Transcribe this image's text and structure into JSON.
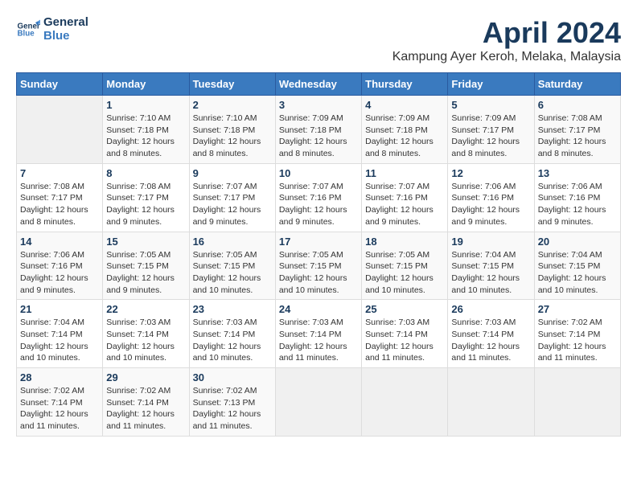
{
  "header": {
    "logo_line1": "General",
    "logo_line2": "Blue",
    "month": "April 2024",
    "location": "Kampung Ayer Keroh, Melaka, Malaysia"
  },
  "weekdays": [
    "Sunday",
    "Monday",
    "Tuesday",
    "Wednesday",
    "Thursday",
    "Friday",
    "Saturday"
  ],
  "weeks": [
    [
      {
        "day": "",
        "sunrise": "",
        "sunset": "",
        "daylight": ""
      },
      {
        "day": "1",
        "sunrise": "7:10 AM",
        "sunset": "7:18 PM",
        "daylight": "12 hours and 8 minutes."
      },
      {
        "day": "2",
        "sunrise": "7:10 AM",
        "sunset": "7:18 PM",
        "daylight": "12 hours and 8 minutes."
      },
      {
        "day": "3",
        "sunrise": "7:09 AM",
        "sunset": "7:18 PM",
        "daylight": "12 hours and 8 minutes."
      },
      {
        "day": "4",
        "sunrise": "7:09 AM",
        "sunset": "7:18 PM",
        "daylight": "12 hours and 8 minutes."
      },
      {
        "day": "5",
        "sunrise": "7:09 AM",
        "sunset": "7:17 PM",
        "daylight": "12 hours and 8 minutes."
      },
      {
        "day": "6",
        "sunrise": "7:08 AM",
        "sunset": "7:17 PM",
        "daylight": "12 hours and 8 minutes."
      }
    ],
    [
      {
        "day": "7",
        "sunrise": "7:08 AM",
        "sunset": "7:17 PM",
        "daylight": "12 hours and 8 minutes."
      },
      {
        "day": "8",
        "sunrise": "7:08 AM",
        "sunset": "7:17 PM",
        "daylight": "12 hours and 9 minutes."
      },
      {
        "day": "9",
        "sunrise": "7:07 AM",
        "sunset": "7:17 PM",
        "daylight": "12 hours and 9 minutes."
      },
      {
        "day": "10",
        "sunrise": "7:07 AM",
        "sunset": "7:16 PM",
        "daylight": "12 hours and 9 minutes."
      },
      {
        "day": "11",
        "sunrise": "7:07 AM",
        "sunset": "7:16 PM",
        "daylight": "12 hours and 9 minutes."
      },
      {
        "day": "12",
        "sunrise": "7:06 AM",
        "sunset": "7:16 PM",
        "daylight": "12 hours and 9 minutes."
      },
      {
        "day": "13",
        "sunrise": "7:06 AM",
        "sunset": "7:16 PM",
        "daylight": "12 hours and 9 minutes."
      }
    ],
    [
      {
        "day": "14",
        "sunrise": "7:06 AM",
        "sunset": "7:16 PM",
        "daylight": "12 hours and 9 minutes."
      },
      {
        "day": "15",
        "sunrise": "7:05 AM",
        "sunset": "7:15 PM",
        "daylight": "12 hours and 9 minutes."
      },
      {
        "day": "16",
        "sunrise": "7:05 AM",
        "sunset": "7:15 PM",
        "daylight": "12 hours and 10 minutes."
      },
      {
        "day": "17",
        "sunrise": "7:05 AM",
        "sunset": "7:15 PM",
        "daylight": "12 hours and 10 minutes."
      },
      {
        "day": "18",
        "sunrise": "7:05 AM",
        "sunset": "7:15 PM",
        "daylight": "12 hours and 10 minutes."
      },
      {
        "day": "19",
        "sunrise": "7:04 AM",
        "sunset": "7:15 PM",
        "daylight": "12 hours and 10 minutes."
      },
      {
        "day": "20",
        "sunrise": "7:04 AM",
        "sunset": "7:15 PM",
        "daylight": "12 hours and 10 minutes."
      }
    ],
    [
      {
        "day": "21",
        "sunrise": "7:04 AM",
        "sunset": "7:14 PM",
        "daylight": "12 hours and 10 minutes."
      },
      {
        "day": "22",
        "sunrise": "7:03 AM",
        "sunset": "7:14 PM",
        "daylight": "12 hours and 10 minutes."
      },
      {
        "day": "23",
        "sunrise": "7:03 AM",
        "sunset": "7:14 PM",
        "daylight": "12 hours and 10 minutes."
      },
      {
        "day": "24",
        "sunrise": "7:03 AM",
        "sunset": "7:14 PM",
        "daylight": "12 hours and 11 minutes."
      },
      {
        "day": "25",
        "sunrise": "7:03 AM",
        "sunset": "7:14 PM",
        "daylight": "12 hours and 11 minutes."
      },
      {
        "day": "26",
        "sunrise": "7:03 AM",
        "sunset": "7:14 PM",
        "daylight": "12 hours and 11 minutes."
      },
      {
        "day": "27",
        "sunrise": "7:02 AM",
        "sunset": "7:14 PM",
        "daylight": "12 hours and 11 minutes."
      }
    ],
    [
      {
        "day": "28",
        "sunrise": "7:02 AM",
        "sunset": "7:14 PM",
        "daylight": "12 hours and 11 minutes."
      },
      {
        "day": "29",
        "sunrise": "7:02 AM",
        "sunset": "7:14 PM",
        "daylight": "12 hours and 11 minutes."
      },
      {
        "day": "30",
        "sunrise": "7:02 AM",
        "sunset": "7:13 PM",
        "daylight": "12 hours and 11 minutes."
      },
      {
        "day": "",
        "sunrise": "",
        "sunset": "",
        "daylight": ""
      },
      {
        "day": "",
        "sunrise": "",
        "sunset": "",
        "daylight": ""
      },
      {
        "day": "",
        "sunrise": "",
        "sunset": "",
        "daylight": ""
      },
      {
        "day": "",
        "sunrise": "",
        "sunset": "",
        "daylight": ""
      }
    ]
  ],
  "labels": {
    "sunrise_prefix": "Sunrise: ",
    "sunset_prefix": "Sunset: ",
    "daylight_prefix": "Daylight: "
  }
}
